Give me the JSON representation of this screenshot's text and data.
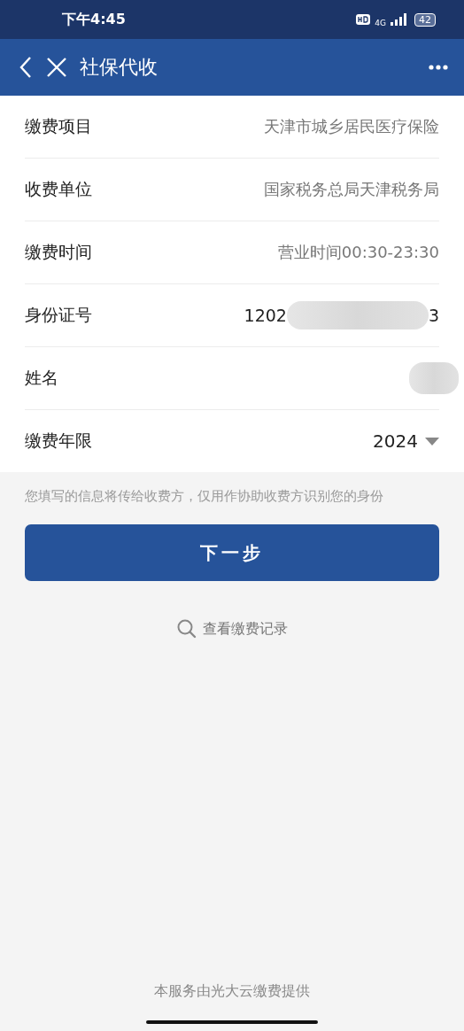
{
  "status_bar": {
    "time": "下午4:45",
    "network": "4G",
    "battery": "42"
  },
  "header": {
    "title": "社保代收"
  },
  "fields": [
    {
      "kind": "text",
      "label": "缴费项目",
      "value": "天津市城乡居民医疗保险"
    },
    {
      "kind": "text",
      "label": "收费单位",
      "value": "国家税务总局天津税务局"
    },
    {
      "kind": "text",
      "label": "缴费时间",
      "value": "营业时间00:30-23:30"
    },
    {
      "kind": "redacted",
      "label": "身份证号",
      "value_start": "1202",
      "value_end": "3"
    },
    {
      "kind": "redacted",
      "label": "姓名"
    },
    {
      "kind": "select",
      "label": "缴费年限",
      "value": "2024"
    }
  ],
  "note": "您填写的信息将传给收费方，仅用作协助收费方识别您的身份",
  "primary_button": "下一步",
  "records_link": "查看缴费记录",
  "footer": "本服务由光大云缴费提供"
}
